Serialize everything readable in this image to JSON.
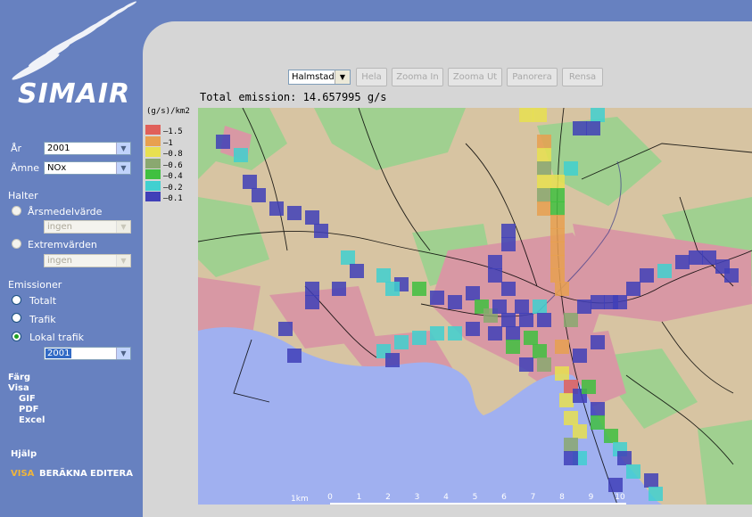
{
  "sidebar": {
    "logo": "SIMAIR",
    "year_label": "År",
    "year_value": "2001",
    "substance_label": "Ämne",
    "substance_value": "NOx",
    "halter_label": "Halter",
    "arsmedel_label": "Årsmedelvärde",
    "arsmedel_select": "ingen",
    "extrem_label": "Extremvärden",
    "extrem_select": "ingen",
    "emissioner_label": "Emissioner",
    "totalt_label": "Totalt",
    "trafik_label": "Trafik",
    "lokal_label": "Lokal trafik",
    "lokal_select": "2001",
    "farg": "Färg",
    "visa": "Visa",
    "gif": "GIF",
    "pdf": "PDF",
    "excel": "Excel",
    "hjalp": "Hjälp",
    "nav_visa": "VISA",
    "nav_berakna": "BERÄKNA",
    "nav_editera": "EDITERA"
  },
  "toolbar": {
    "city": "Halmstad",
    "hela": "Hela",
    "zoom_in": "Zooma In",
    "zoom_out": "Zooma Ut",
    "pan": "Panorera",
    "clear": "Rensa"
  },
  "total_emission": "Total emission: 14.657995 g/s",
  "legend": {
    "title": "(g/s)/km2",
    "items": [
      {
        "label": "1.5",
        "color": "#e0605a"
      },
      {
        "label": "1",
        "color": "#e8a050"
      },
      {
        "label": "0.8",
        "color": "#e8e050"
      },
      {
        "label": "0.6",
        "color": "#8aa870"
      },
      {
        "label": "0.4",
        "color": "#40c040"
      },
      {
        "label": "0.2",
        "color": "#40d0d0"
      },
      {
        "label": "0.1",
        "color": "#4040b8"
      }
    ]
  },
  "scale": {
    "unit": "1km",
    "ticks": [
      "0",
      "1",
      "2",
      "3",
      "4",
      "5",
      "6",
      "7",
      "8",
      "9",
      "10"
    ]
  },
  "colors": {
    "sidebar": "#6781c0",
    "panel": "#d6d6d6",
    "sea": "#a0b0f0",
    "land": "#d7c4a2",
    "green": "#a0d090",
    "urban": "#d898a4",
    "accent": "#f0b53b"
  }
}
